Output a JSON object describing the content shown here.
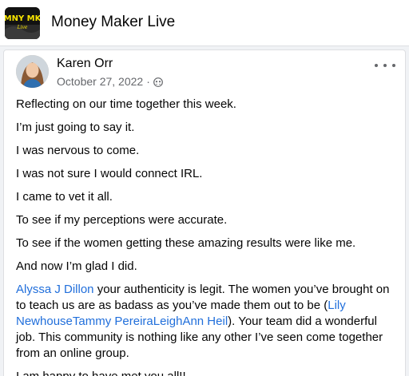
{
  "header": {
    "group_name": "Money Maker Live",
    "logo_text": "MNY MKR"
  },
  "post": {
    "author": "Karen Orr",
    "date": "October 27, 2022",
    "separator": "·",
    "privacy_icon": "group-members-icon",
    "more_icon": "more-options-icon",
    "paragraphs": [
      "Reflecting on our time together this week.",
      "I’m just going to say it.",
      "I was nervous to come.",
      "I was not sure I would connect IRL.",
      "I came to vet it all.",
      "To see if my perceptions were accurate.",
      "To see if the women getting these amazing results were like me.",
      "And now I’m glad I did."
    ],
    "mention_paragraph": {
      "mention_1": "Alyssa J Dillon",
      "text_1": " your authenticity is legit. The  women you’ve brought on to teach us are as badass as you’ve made them out to be (",
      "mention_2": "Lily Newhouse",
      "mention_3": "Tammy Pereira",
      "mention_4": "LeighAnn Heil",
      "text_2": "). Your team did a wonderful job. This community is nothing like any other I’ve seen come together from an online group."
    },
    "closing": "I am happy to have met you all!!"
  },
  "colors": {
    "link": "#216fdb",
    "secondary_text": "#65676b",
    "background": "#f0f2f5"
  }
}
